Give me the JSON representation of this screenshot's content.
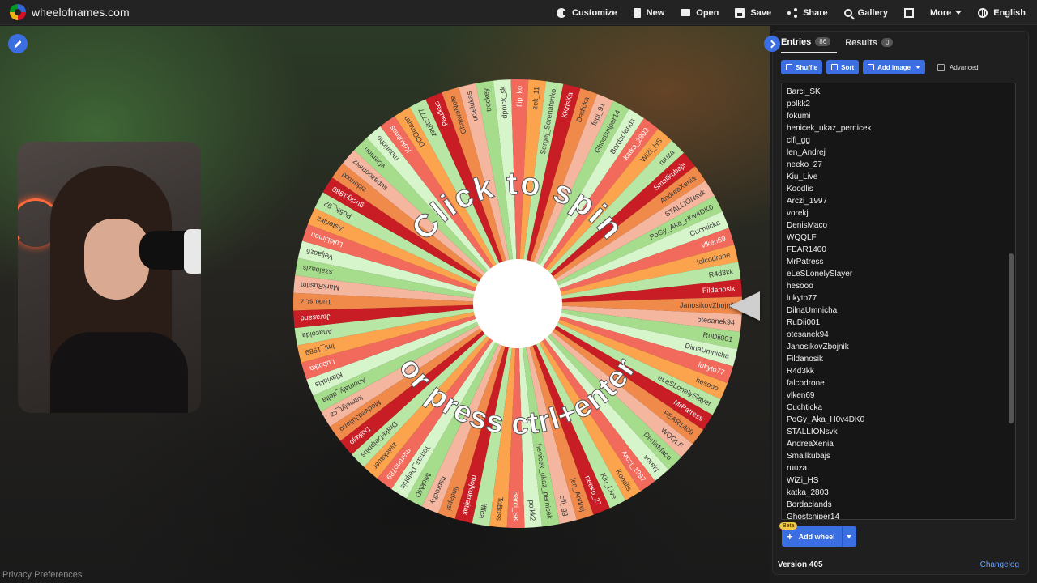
{
  "header": {
    "site_name": "wheelofnames.com",
    "menu": [
      {
        "label": "Customize",
        "icon": "palette-icon"
      },
      {
        "label": "New",
        "icon": "file-icon"
      },
      {
        "label": "Open",
        "icon": "folder-icon"
      },
      {
        "label": "Save",
        "icon": "save-icon"
      },
      {
        "label": "Share",
        "icon": "share-icon"
      },
      {
        "label": "Gallery",
        "icon": "search-icon"
      },
      {
        "label": "More",
        "icon": "chevron-down-icon"
      },
      {
        "label": "English",
        "icon": "globe-icon"
      }
    ]
  },
  "wheel": {
    "text_top": "Click to spin",
    "text_bottom": "or press ctrl+enter",
    "colors": [
      "#c81d25",
      "#f08a4b",
      "#f5b6a0",
      "#a6dd8c",
      "#d7f5cb",
      "#f26a5b",
      "#fca34d",
      "#b8e6a4"
    ],
    "segment_names": [
      "Fildanosik",
      "JanosikovZbojnik",
      "otesanek94",
      "RuDii001",
      "DilnaUmnicha",
      "lukyto77",
      "hesooo",
      "eLeSLonelySlayer",
      "MrPatress",
      "FEAR1400",
      "WQQLF",
      "DenisMaco",
      "vorekj",
      "Arczi_1997",
      "Koodlis",
      "Kiu_Live",
      "neeko_27",
      "len_Andrej",
      "cifi_gg",
      "henicek_ukaz_pernicek",
      "polkk2",
      "Barci_SK",
      "ToBoss",
      "ifffca",
      "mojkokrajtak",
      "lindapsi",
      "Itsprodhy",
      "MickMD",
      "Tomas_Delphis",
      "martino789",
      "zwickauer",
      "DrakeDelphius",
      "Dolkejo",
      "MedvedJuliano",
      "kamelyt_cz",
      "Anomaly_delta",
      "Klaviakis",
      "Lubotka",
      "lmi_1989",
      "Anacolda",
      "Jarasand",
      "TurkusCZ",
      "MarkRustim",
      "szaloazis",
      "Veljaoz6",
      "LukiLimon",
      "Asterijkz",
      "Po5K_92",
      "gucky1980",
      "zidomxxl",
      "supazoomerz",
      "vDemon",
      "mourinho",
      "Kokulinos",
      "DOOmsan",
      "zaqitz777",
      "Paulkas",
      "ChalwaNote",
      "uclelukas",
      "trockey",
      "dpnick_sk",
      "flip_ko",
      "zek_11",
      "Sergej_Serenatenko",
      "KKrisKa",
      "Dadicka",
      "fugi_91",
      "Ghostsniper14",
      "Bordaclands",
      "katka_2803",
      "WiZi_HS",
      "ruuza",
      "Smallkubajs",
      "AndreaXenia",
      "STALLIONsvk",
      "PoGy_Aka_H0v4DK0",
      "Cuchticka",
      "vlken69",
      "falcodrone",
      "R4d3kk"
    ]
  },
  "panel": {
    "tabs": [
      {
        "label": "Entries",
        "count": "86"
      },
      {
        "label": "Results",
        "count": "0"
      }
    ],
    "toolbar": {
      "shuffle": "Shuffle",
      "sort": "Sort",
      "add_image": "Add image",
      "advanced": "Advanced"
    },
    "entries": [
      "Barci_SK",
      "polkk2",
      "fokumi",
      "henicek_ukaz_pernicek",
      "cifi_gg",
      "len_Andrej",
      "neeko_27",
      "Kiu_Live",
      "Koodlis",
      "Arczi_1997",
      "vorekj",
      "DenisMaco",
      "WQQLF",
      "FEAR1400",
      "MrPatress",
      "eLeSLonelySlayer",
      "hesooo",
      "lukyto77",
      "DilnaUmnicha",
      "RuDii001",
      "otesanek94",
      "JanosikovZbojnik",
      "Fildanosik",
      "R4d3kk",
      "falcodrone",
      "vlken69",
      "Cuchticka",
      "PoGy_Aka_H0v4DK0",
      "STALLIONsvk",
      "AndreaXenia",
      "Smallkubajs",
      "ruuza",
      "WiZi_HS",
      "katka_2803",
      "Bordaclands",
      "Ghostsniper14"
    ],
    "beta_label": "Beta",
    "add_wheel": "Add wheel",
    "version": "Version 405",
    "changelog": "Changelog"
  },
  "footer": {
    "privacy": "Privacy Preferences"
  }
}
